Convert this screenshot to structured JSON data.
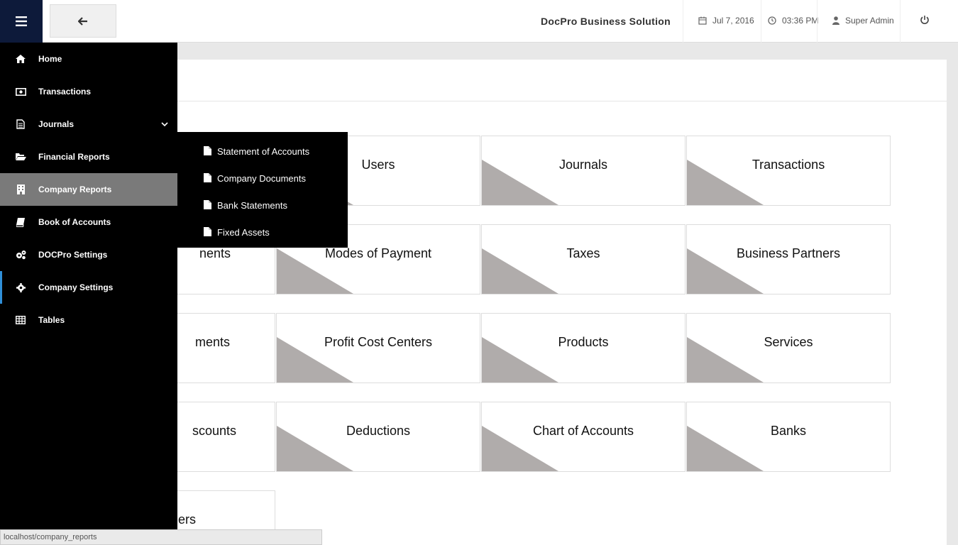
{
  "header": {
    "brand": "DocPro Business Solution",
    "date": "Jul 7, 2016",
    "time": "03:36 PM",
    "user": "Super Admin"
  },
  "sidebar": {
    "items": [
      {
        "label": "Home",
        "icon": "home-icon"
      },
      {
        "label": "Transactions",
        "icon": "money-icon"
      },
      {
        "label": "Journals",
        "icon": "file-text-icon"
      },
      {
        "label": "Financial Reports",
        "icon": "folder-open-icon"
      },
      {
        "label": "Company Reports",
        "icon": "building-icon"
      },
      {
        "label": "Book of Accounts",
        "icon": "book-icon"
      },
      {
        "label": "DOCPro Settings",
        "icon": "cogs-icon"
      },
      {
        "label": "Company Settings",
        "icon": "gear-icon"
      },
      {
        "label": "Tables",
        "icon": "table-icon"
      }
    ]
  },
  "submenu": {
    "items": [
      {
        "label": "Statement of Accounts"
      },
      {
        "label": "Company Documents"
      },
      {
        "label": "Bank Statements"
      },
      {
        "label": "Fixed Assets"
      }
    ]
  },
  "tiles": {
    "r0c1": "Users",
    "r0c2": "Journals",
    "r0c3": "Transactions",
    "r1c0": "nents",
    "r1c1": "Modes of Payment",
    "r1c2": "Taxes",
    "r1c3": "Business Partners",
    "r2c0": "ments",
    "r2c1": "Profit Cost Centers",
    "r2c2": "Products",
    "r2c3": "Services",
    "r3c0": "scounts",
    "r3c1": "Deductions",
    "r3c2": "Chart of Accounts",
    "r3c3": "Banks",
    "r4c0": "ers"
  },
  "statusbar": {
    "url": "localhost/company_reports"
  },
  "colors": {
    "sidebar_bg": "#000000",
    "active_item": "#7a7a7a",
    "accent": "#2f8fd8",
    "toggle_bg": "#0d1a3a",
    "tile_triangle": "#b0acab"
  }
}
